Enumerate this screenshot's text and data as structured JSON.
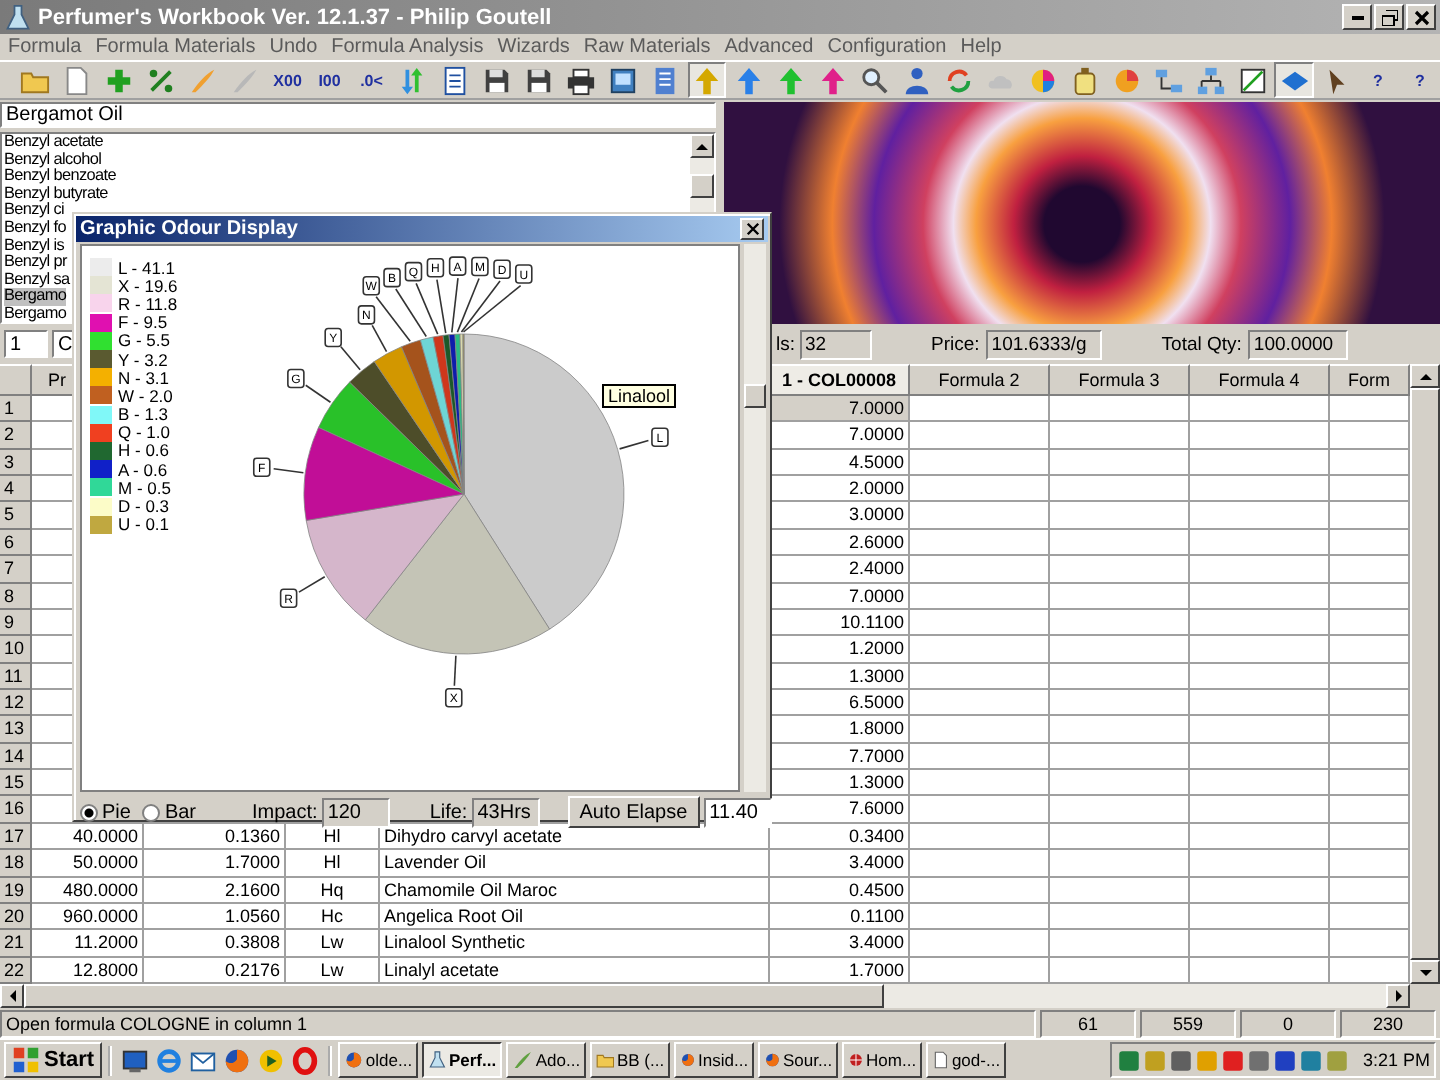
{
  "window": {
    "title": "Perfumer's Workbook Ver. 12.1.37 - Philip Goutell"
  },
  "menu": [
    "Formula",
    "Formula Materials",
    "Undo",
    "Formula Analysis",
    "Wizards",
    "Raw Materials",
    "Advanced",
    "Configuration",
    "Help"
  ],
  "toolbar": [
    {
      "kind": "folder",
      "selected": false
    },
    {
      "kind": "page",
      "selected": false
    },
    {
      "kind": "plus",
      "selected": false
    },
    {
      "kind": "percent",
      "selected": false
    },
    {
      "kind": "brush",
      "selected": false
    },
    {
      "kind": "feather",
      "selected": false
    },
    {
      "kind": "text",
      "label": "X00",
      "selected": false
    },
    {
      "kind": "text",
      "label": "I00",
      "selected": false
    },
    {
      "kind": "text",
      "label": ".0<",
      "selected": false
    },
    {
      "kind": "arrows",
      "selected": false
    },
    {
      "kind": "notepad",
      "selected": false
    },
    {
      "kind": "save",
      "selected": false
    },
    {
      "kind": "save",
      "selected": false
    },
    {
      "kind": "printer",
      "selected": false
    },
    {
      "kind": "picture",
      "selected": false
    },
    {
      "kind": "document",
      "selected": false
    },
    {
      "kind": "up-arrow",
      "color": "#d4a800",
      "selected": true
    },
    {
      "kind": "up-arrow",
      "color": "#2a80e8",
      "selected": false
    },
    {
      "kind": "up-arrow",
      "color": "#20c030",
      "selected": false
    },
    {
      "kind": "up-arrow",
      "color": "#e0208a",
      "selected": false
    },
    {
      "kind": "magnifier",
      "selected": false
    },
    {
      "kind": "person",
      "selected": false
    },
    {
      "kind": "refresh",
      "selected": false
    },
    {
      "kind": "cloud",
      "selected": false
    },
    {
      "kind": "wheel",
      "selected": false
    },
    {
      "kind": "bottle",
      "selected": false
    },
    {
      "kind": "pie",
      "selected": false
    },
    {
      "kind": "flow",
      "selected": false
    },
    {
      "kind": "tree",
      "selected": false
    },
    {
      "kind": "chart",
      "selected": false
    },
    {
      "kind": "diamond",
      "selected": true
    },
    {
      "kind": "pointer",
      "selected": false
    },
    {
      "kind": "text",
      "label": "?",
      "selected": false
    },
    {
      "kind": "text",
      "label": "?",
      "selected": false
    }
  ],
  "material_field": {
    "value": "Bergamot Oil"
  },
  "materials": [
    {
      "label": "Benzyl acetate",
      "selected": false
    },
    {
      "label": "Benzyl alcohol",
      "selected": false
    },
    {
      "label": "Benzyl benzoate",
      "selected": false
    },
    {
      "label": "Benzyl butyrate",
      "selected": false
    },
    {
      "label": "Benzyl ci",
      "selected": false
    },
    {
      "label": "Benzyl fo",
      "selected": false
    },
    {
      "label": "Benzyl is",
      "selected": false
    },
    {
      "label": "Benzyl pr",
      "selected": false
    },
    {
      "label": "Benzyl sa",
      "selected": false
    },
    {
      "label": "Bergamo",
      "selected": true
    },
    {
      "label": "Bergamo",
      "selected": false
    }
  ],
  "info": {
    "column_field": "1",
    "name_field": "C",
    "materials_label": "ls:",
    "materials_value": "32",
    "price_label": "Price:",
    "price_value": "101.6333/g",
    "qty_label": "Total Qty:",
    "qty_value": "100.0000"
  },
  "grid": {
    "left_header": "Pr",
    "columns": [
      "1 - COL00008",
      "Formula 2",
      "Formula 3",
      "Formula 4",
      "Form"
    ],
    "rows": [
      {
        "num": "1",
        "value": "7.0000",
        "selected": true
      },
      {
        "num": "2",
        "value": "7.0000",
        "selected": false
      },
      {
        "num": "3",
        "value": "4.5000",
        "selected": false
      },
      {
        "num": "4",
        "value": "2.0000",
        "selected": false
      },
      {
        "num": "5",
        "value": "3.0000",
        "selected": false
      },
      {
        "num": "6",
        "value": "2.6000",
        "selected": false
      },
      {
        "num": "7",
        "value": "2.4000",
        "selected": false
      },
      {
        "num": "8",
        "value": "7.0000",
        "selected": false
      },
      {
        "num": "9",
        "value": "10.1100",
        "selected": false
      },
      {
        "num": "10",
        "value": "1.2000",
        "selected": false
      },
      {
        "num": "11",
        "value": "1.3000",
        "selected": false
      },
      {
        "num": "12",
        "value": "6.5000",
        "selected": false
      },
      {
        "num": "13",
        "value": "1.8000",
        "selected": false
      },
      {
        "num": "14",
        "value": "7.7000",
        "selected": false
      },
      {
        "num": "15",
        "value": "1.3000",
        "selected": false
      },
      {
        "num": "16",
        "value": "7.6000",
        "selected": false
      },
      {
        "num": "17",
        "qty": "40.0000",
        "price": "0.1360",
        "code": "Hl",
        "name": "Dihydro carvyl acetate",
        "value": "0.3400",
        "selected": false
      },
      {
        "num": "18",
        "qty": "50.0000",
        "price": "1.7000",
        "code": "Hl",
        "name": "Lavender Oil",
        "value": "3.4000",
        "selected": false
      },
      {
        "num": "19",
        "qty": "480.0000",
        "price": "2.1600",
        "code": "Hq",
        "name": "Chamomile Oil Maroc",
        "value": "0.4500",
        "selected": false
      },
      {
        "num": "20",
        "qty": "960.0000",
        "price": "1.0560",
        "code": "Hc",
        "name": "Angelica Root Oil",
        "value": "0.1100",
        "selected": false
      },
      {
        "num": "21",
        "qty": "11.2000",
        "price": "0.3808",
        "code": "Lw",
        "name": "Linalool Synthetic",
        "value": "3.4000",
        "selected": false
      },
      {
        "num": "22",
        "qty": "12.8000",
        "price": "0.2176",
        "code": "Lw",
        "name": "Linalyl acetate",
        "value": "1.7000",
        "selected": false
      }
    ]
  },
  "dialog": {
    "title": "Graphic Odour Display",
    "legend": [
      {
        "label": "L - 41.1",
        "color": "#ececec"
      },
      {
        "label": "X - 19.6",
        "color": "#e4e4d4"
      },
      {
        "label": "R - 11.8",
        "color": "#f8d4ec"
      },
      {
        "label": "F - 9.5",
        "color": "#e010b0"
      },
      {
        "label": "G - 5.5",
        "color": "#30e030"
      },
      {
        "label": "Y - 3.2",
        "color": "#5a5a30"
      },
      {
        "label": "N - 3.1",
        "color": "#f4b000"
      },
      {
        "label": "W - 2.0",
        "color": "#c06020"
      },
      {
        "label": "B - 1.3",
        "color": "#80f8f8"
      },
      {
        "label": "Q - 1.0",
        "color": "#f04020"
      },
      {
        "label": "H - 0.6",
        "color": "#206830"
      },
      {
        "label": "A - 0.6",
        "color": "#1020c8"
      },
      {
        "label": "M - 0.5",
        "color": "#30d898"
      },
      {
        "label": "D - 0.3",
        "color": "#fcfcc8"
      },
      {
        "label": "U - 0.1",
        "color": "#c0a840"
      }
    ],
    "chart_data": {
      "type": "pie",
      "categories": [
        "L",
        "X",
        "R",
        "F",
        "G",
        "Y",
        "N",
        "W",
        "B",
        "Q",
        "H",
        "A",
        "M",
        "D",
        "U"
      ],
      "values": [
        41.1,
        19.6,
        11.8,
        9.5,
        5.5,
        3.2,
        3.1,
        2.0,
        1.3,
        1.0,
        0.6,
        0.6,
        0.5,
        0.3,
        0.1
      ]
    },
    "tooltip": "Linalool",
    "view_options": [
      {
        "label": "Pie",
        "selected": true
      },
      {
        "label": "Bar",
        "selected": false
      }
    ],
    "impact_label": "Impact:",
    "impact_value": "120",
    "life_label": "Life:",
    "life_value": "43Hrs",
    "auto_button": "Auto Elapse",
    "elapse_value": "11.40"
  },
  "status_bar": {
    "message": "Open formula COLOGNE in column 1",
    "panels": [
      "61",
      "559",
      "0",
      "230"
    ]
  },
  "taskbar": {
    "start": "Start",
    "tasks": [
      {
        "label": "olde...",
        "selected": false
      },
      {
        "label": "Perf...",
        "selected": true
      },
      {
        "label": "Ado...",
        "selected": false
      },
      {
        "label": "BB (...",
        "selected": false
      },
      {
        "label": "Insid...",
        "selected": false
      },
      {
        "label": "Sour...",
        "selected": false
      },
      {
        "label": "Hom...",
        "selected": false
      },
      {
        "label": "god-...",
        "selected": false
      }
    ],
    "clock": "3:21 PM"
  }
}
